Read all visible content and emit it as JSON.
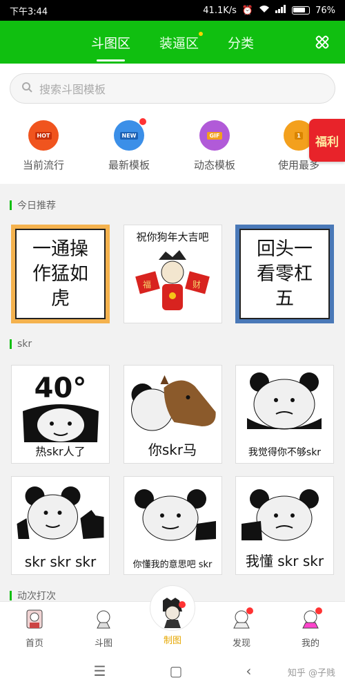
{
  "status_bar": {
    "time": "下午3:44",
    "network_speed": "41.1K/s",
    "battery": "76%"
  },
  "header": {
    "tabs": [
      {
        "label": "斗图区",
        "active": true
      },
      {
        "label": "装逼区",
        "has_dot": true
      },
      {
        "label": "分类"
      }
    ],
    "icon": "tools-icon"
  },
  "search": {
    "placeholder": "搜索斗图模板"
  },
  "quick_links": [
    {
      "label": "当前流行",
      "badge": "HOT",
      "color": "#f0541e"
    },
    {
      "label": "最新模板",
      "badge": "NEW",
      "color": "#3b8fe8"
    },
    {
      "label": "动态模板",
      "badge": "GIF",
      "color": "#b15ad8"
    },
    {
      "label": "使用最多",
      "badge": "1",
      "color": "#f3a01d"
    }
  ],
  "promo": {
    "label": "福利"
  },
  "sections": [
    {
      "title": "今日推荐",
      "cards": [
        {
          "text_lines": [
            "一通操",
            "作猛如",
            "虎"
          ],
          "style": "orange"
        },
        {
          "caption": "祝你狗年大吉吧"
        },
        {
          "text_lines": [
            "回头一",
            "看零杠",
            "五"
          ],
          "style": "blue"
        }
      ]
    },
    {
      "title": "skr",
      "cards": [
        {
          "caption": "热skr人了",
          "big": "40°"
        },
        {
          "caption": "你skr马"
        },
        {
          "caption": "我觉得你不够skr"
        },
        {
          "caption": "skr skr skr"
        },
        {
          "caption": "你懂我的意思吧 skr"
        },
        {
          "caption": "我懂 skr skr"
        }
      ]
    },
    {
      "title": "动次打次"
    }
  ],
  "bottom_nav": [
    {
      "label": "首页"
    },
    {
      "label": "斗图"
    },
    {
      "label": "制图",
      "center": true
    },
    {
      "label": "发现",
      "has_dot": true
    },
    {
      "label": "我的",
      "has_dot": true
    }
  ],
  "watermark": "知乎 @子贱"
}
